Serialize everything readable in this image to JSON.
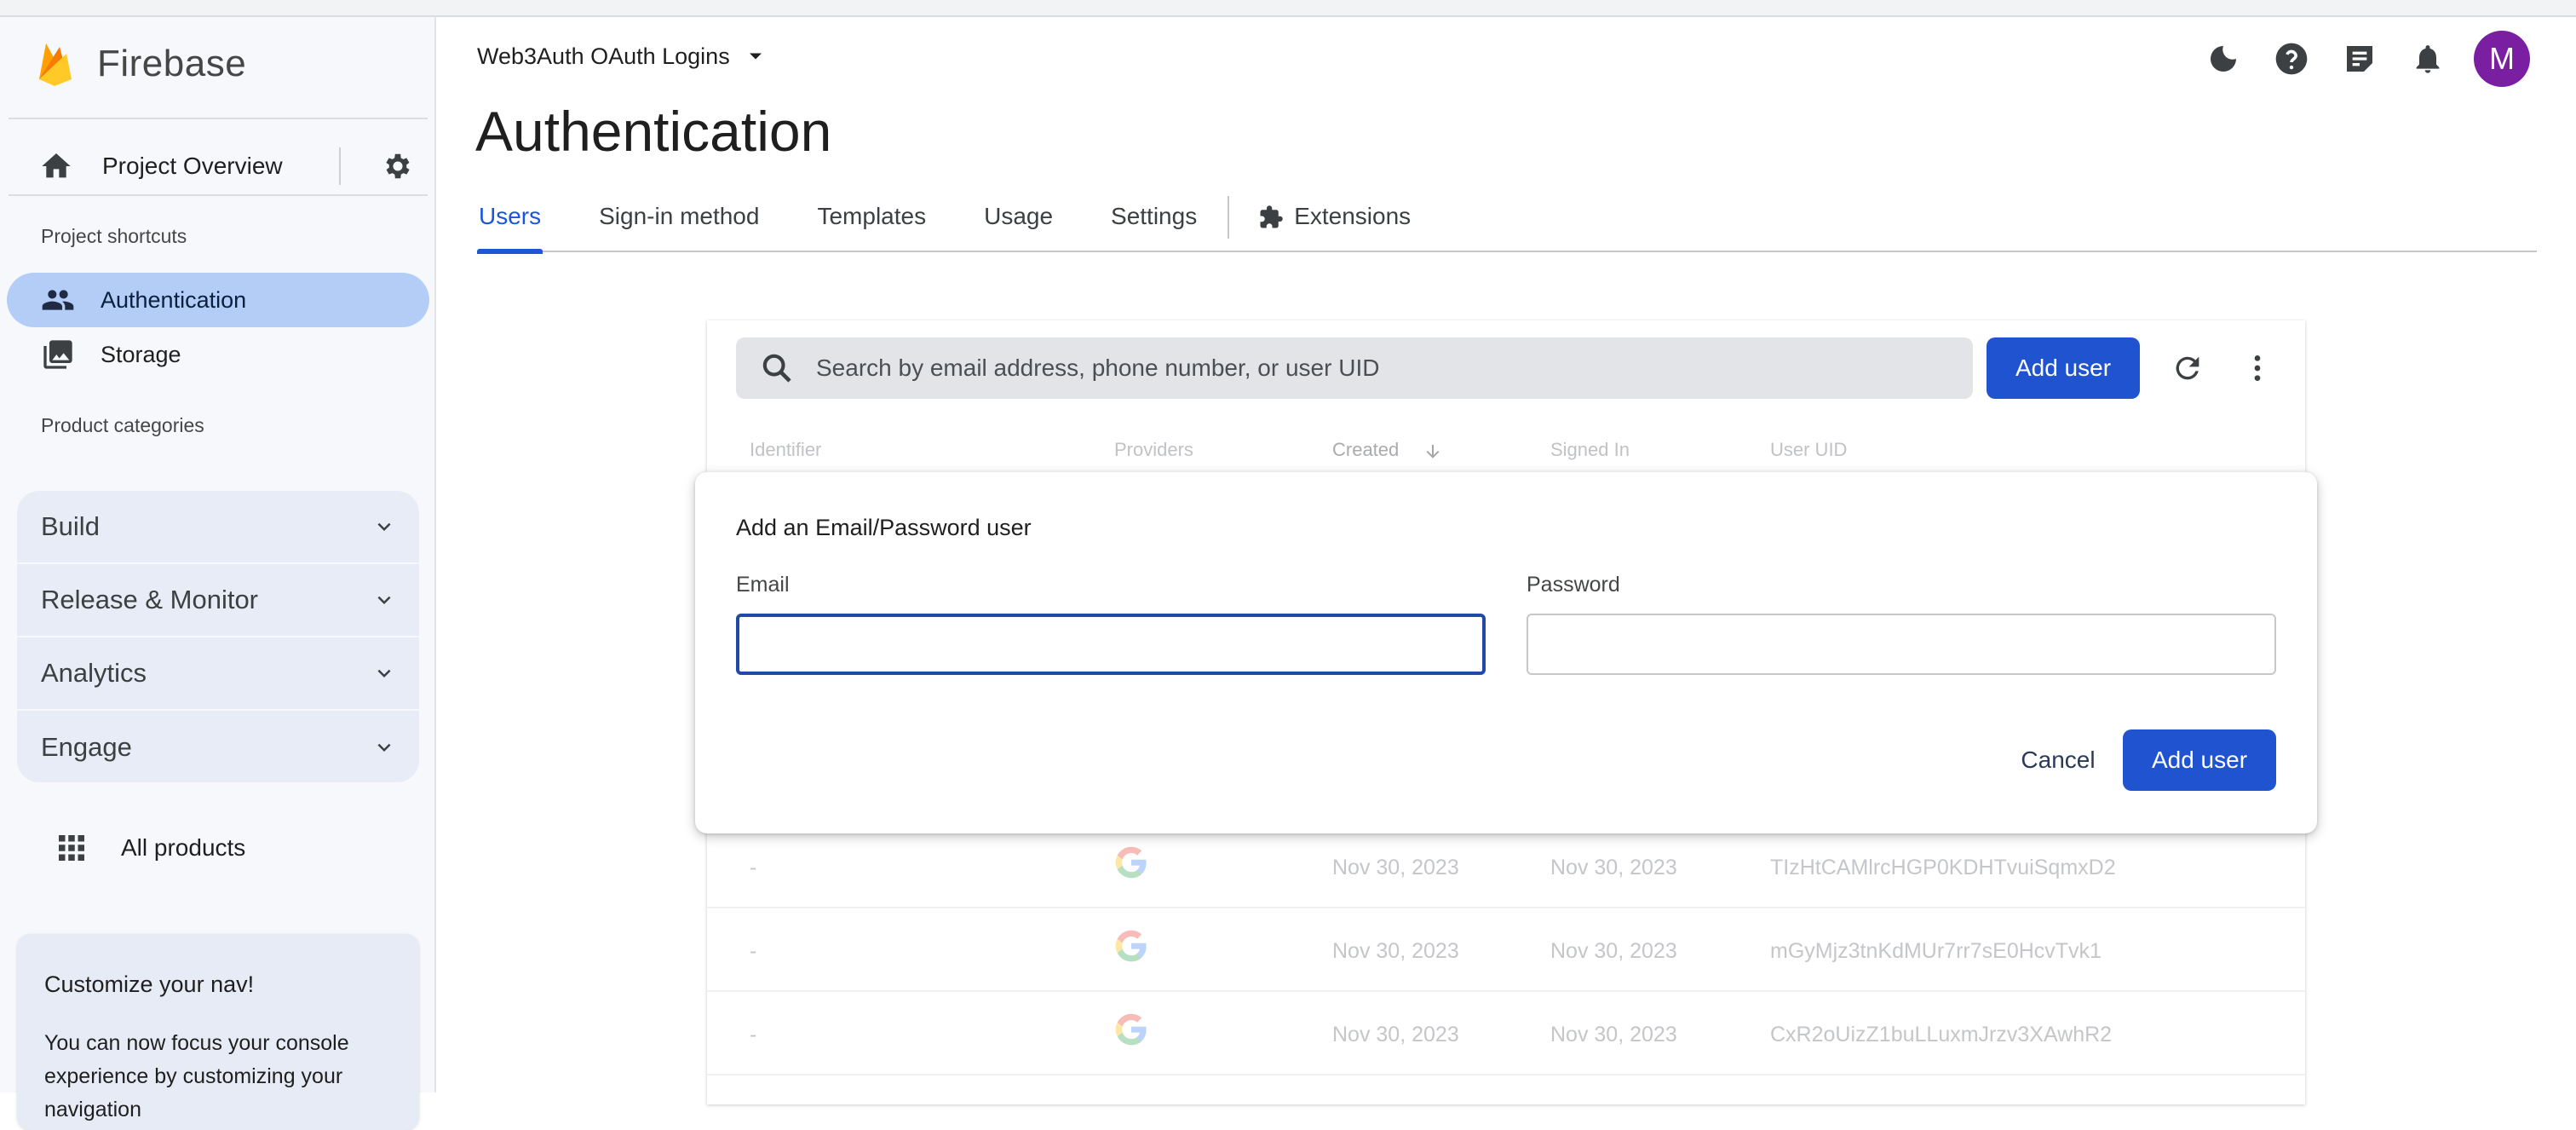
{
  "brand": {
    "name": "Firebase"
  },
  "sidebar": {
    "overview_label": "Project Overview",
    "shortcuts_heading": "Project shortcuts",
    "shortcuts": [
      {
        "label": "Authentication",
        "icon": "people-icon",
        "active": true
      },
      {
        "label": "Storage",
        "icon": "image-icon",
        "active": false
      }
    ],
    "categories_heading": "Product categories",
    "categories": [
      {
        "label": "Build"
      },
      {
        "label": "Release & Monitor"
      },
      {
        "label": "Analytics"
      },
      {
        "label": "Engage"
      }
    ],
    "all_products_label": "All products",
    "customize": {
      "title": "Customize your nav!",
      "body": "You can now focus your console experience by customizing your navigation"
    }
  },
  "header": {
    "project_name": "Web3Auth OAuth Logins",
    "avatar_letter": "M",
    "avatar_color": "#7b1fa2"
  },
  "page": {
    "title": "Authentication",
    "tabs": [
      {
        "label": "Users",
        "active": true
      },
      {
        "label": "Sign-in method"
      },
      {
        "label": "Templates"
      },
      {
        "label": "Usage"
      },
      {
        "label": "Settings"
      },
      {
        "label": "Extensions"
      }
    ]
  },
  "users": {
    "search_placeholder": "Search by email address, phone number, or user UID",
    "add_user_label": "Add user",
    "columns": [
      "Identifier",
      "Providers",
      "Created",
      "Signed In",
      "User UID"
    ],
    "rows": [
      {
        "identifier": "-",
        "provider": "google",
        "created": "Nov 30, 2023",
        "signed_in": "Nov 30, 2023",
        "uid": "TIzHtCAMlrcHGP0KDHTvuiSqmxD2"
      },
      {
        "identifier": "-",
        "provider": "google",
        "created": "Nov 30, 2023",
        "signed_in": "Nov 30, 2023",
        "uid": "mGyMjz3tnKdMUr7rr7sE0HcvTvk1"
      },
      {
        "identifier": "-",
        "provider": "google",
        "created": "Nov 30, 2023",
        "signed_in": "Nov 30, 2023",
        "uid": "CxR2oUizZ1buLLuxmJrzv3XAwhR2"
      }
    ]
  },
  "dialog": {
    "title": "Add an Email/Password user",
    "email_label": "Email",
    "email_value": "",
    "password_label": "Password",
    "password_value": "",
    "cancel_label": "Cancel",
    "add_label": "Add user"
  },
  "colors": {
    "primary": "#2053cf",
    "active_nav": "#b3cdf6",
    "tab_active": "#1a56db"
  }
}
